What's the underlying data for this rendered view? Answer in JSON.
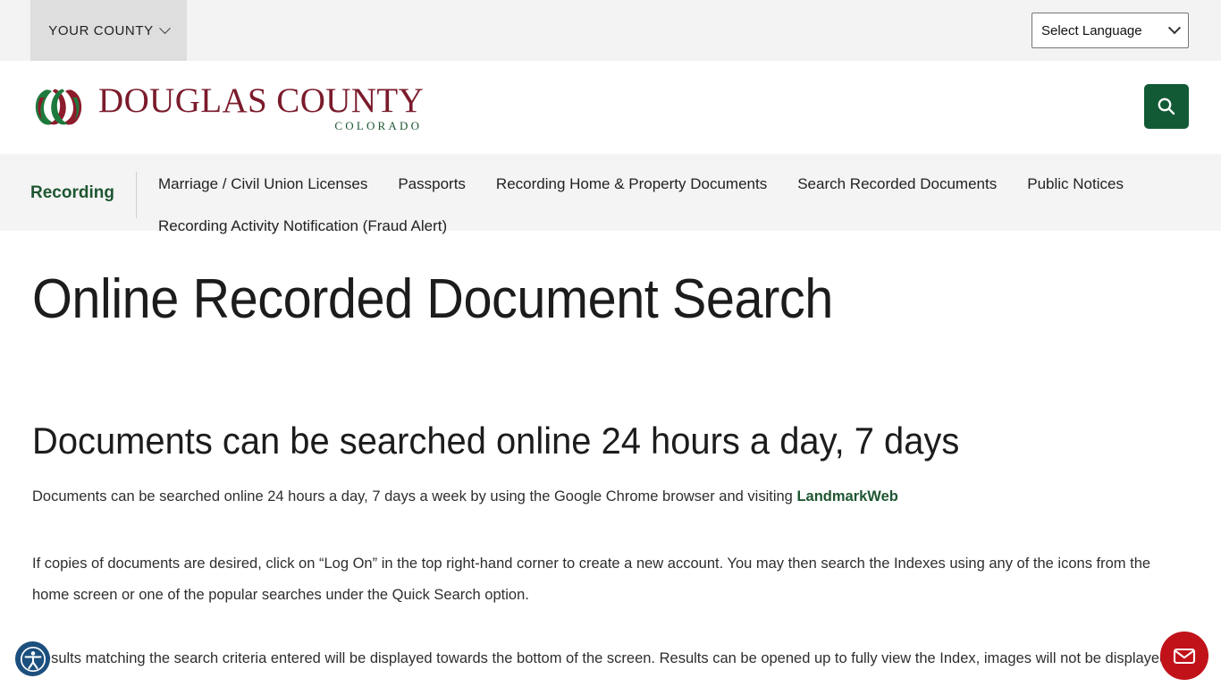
{
  "utility_bar": {
    "county_tab_label": "YOUR COUNTY",
    "county_tab_icon": "chevron-down-icon",
    "language_select_value": "Select Language",
    "language_select_icon": "chevron-down-icon"
  },
  "masthead": {
    "logo_title": "DOUGLAS COUNTY",
    "logo_subtitle": "COLORADO",
    "logo_mark_icon": "double-swirl-logo-icon",
    "search_icon": "search-icon"
  },
  "section_nav": {
    "title": "Recording",
    "links": [
      "Marriage / Civil Union Licenses",
      "Passports",
      "Recording Home & Property Documents",
      "Search Recorded Documents",
      "Public Notices",
      "Recording Activity Notification (Fraud Alert)"
    ]
  },
  "main": {
    "page_title": "Online Recorded Document Search",
    "sub_heading": "Documents can be searched online 24 hours a day, 7 days",
    "paragraph1_before_link": "Documents can be searched online 24 hours a day, 7 days a week by using the Google Chrome browser and visiting ",
    "paragraph1_link": "LandmarkWeb",
    "paragraph2": "If copies of documents are desired, click on “Log On” in the top right-hand corner to create a new account. You may then search the Indexes using any of the icons from the home screen or one of the popular searches under the Quick Search option.",
    "paragraph3": "Results matching the search criteria entered will be displayed towards the bottom of the screen. Results can be opened up to fully view the Index, images will not be displayed."
  },
  "widgets": {
    "accessibility_icon": "accessibility-person-icon",
    "chat_icon": "envelope-icon"
  },
  "colors": {
    "brand_green": "#1e5631",
    "search_button_green": "#125a35",
    "logo_maroon": "#7a1b2b",
    "accessibility_blue": "#1b4f7e",
    "chat_red": "#c1121a",
    "utility_bar_bg": "#f3f3f3",
    "county_tab_bg": "#dedede",
    "section_nav_bg": "#f4f4f4"
  }
}
